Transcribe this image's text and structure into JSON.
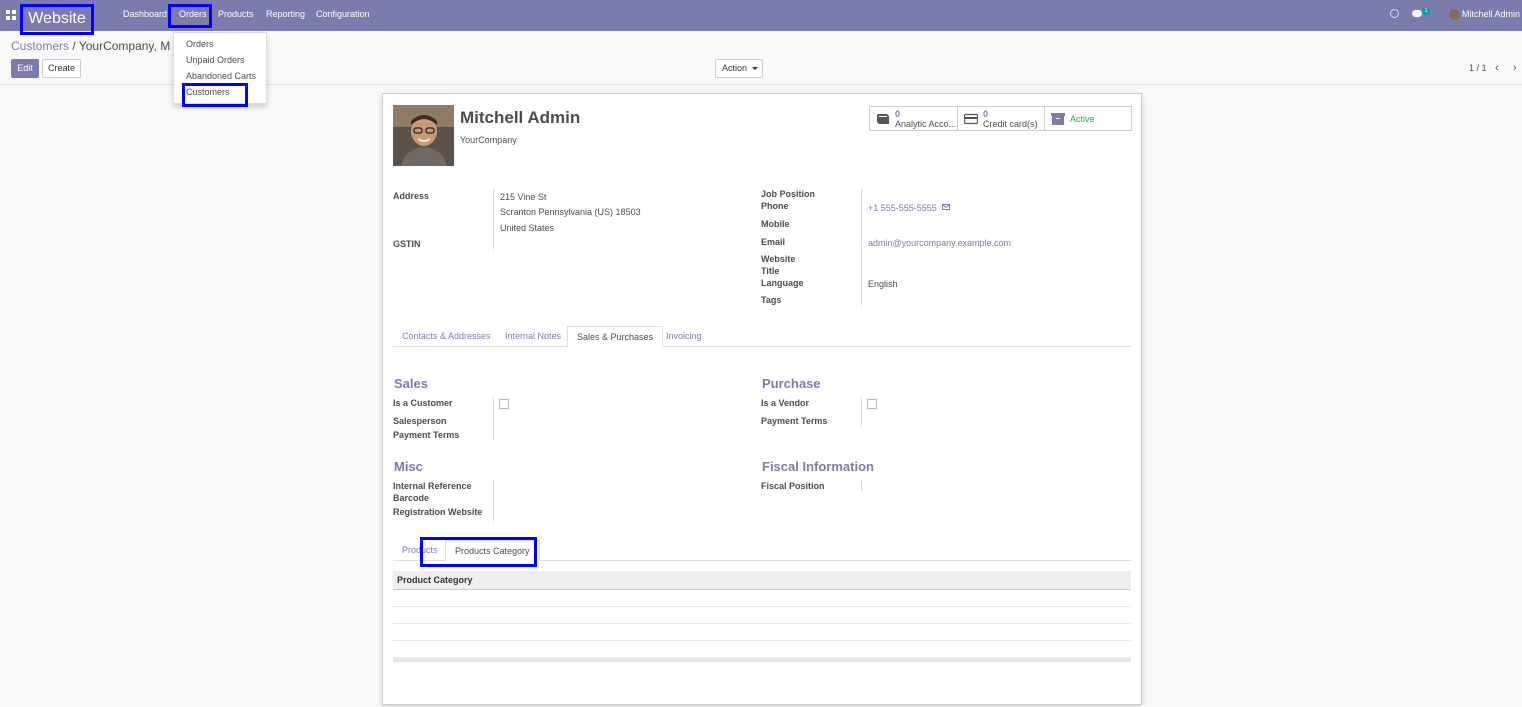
{
  "navbar": {
    "brand": "Website",
    "menu": [
      "Dashboard",
      "Orders",
      "Products",
      "Reporting",
      "Configuration"
    ],
    "chat_count": "1",
    "user": "Mitchell Admin"
  },
  "dropdown": {
    "items": [
      "Orders",
      "Unpaid Orders",
      "Abandoned Carts",
      "Customers"
    ]
  },
  "control_panel": {
    "breadcrumb_root": "Customers",
    "breadcrumb_sep": "/",
    "breadcrumb_current": "YourCompany, M",
    "edit_label": "Edit",
    "create_label": "Create",
    "action_label": "Action",
    "pager": "1 / 1"
  },
  "record": {
    "name": "Mitchell Admin",
    "company": "YourCompany",
    "stats": {
      "analytic_count": "0",
      "analytic_label": "Analytic Acco...",
      "card_count": "0",
      "card_label": "Credit card(s)",
      "active_label": "Active"
    },
    "left_fields": {
      "address_label": "Address",
      "address_line1": "215 Vine St",
      "address_line2": "Scranton  Pennsylvania (US)  18503",
      "address_line3": "United States",
      "gstin_label": "GSTIN"
    },
    "right_fields": {
      "job_position_label": "Job Position",
      "phone_label": "Phone",
      "phone_value": "+1 555-555-5555",
      "mobile_label": "Mobile",
      "email_label": "Email",
      "email_value": "admin@yourcompany.example.com",
      "website_label": "Website",
      "title_label": "Title",
      "language_label": "Language",
      "language_value": "English",
      "tags_label": "Tags"
    }
  },
  "tabs": [
    "Contacts & Addresses",
    "Internal Notes",
    "Sales & Purchases",
    "Invoicing"
  ],
  "sales": {
    "title": "Sales",
    "is_customer_label": "Is a Customer",
    "salesperson_label": "Salesperson",
    "payment_terms_label": "Payment Terms"
  },
  "purchase": {
    "title": "Purchase",
    "is_vendor_label": "Is a Vendor",
    "payment_terms_label": "Payment Terms"
  },
  "misc": {
    "title": "Misc",
    "internal_ref_label": "Internal Reference",
    "barcode_label": "Barcode",
    "reg_website_label": "Registration Website"
  },
  "fiscal": {
    "title": "Fiscal Information",
    "fiscal_position_label": "Fiscal Position"
  },
  "subtabs": [
    "Products",
    "Products Category"
  ],
  "category_table": {
    "header": "Product Category"
  }
}
